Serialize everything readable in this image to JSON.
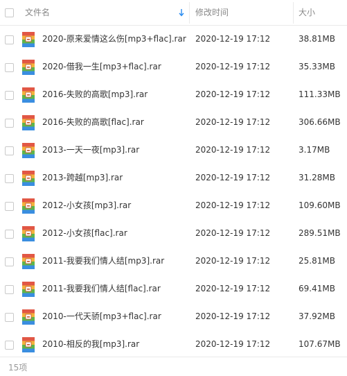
{
  "header": {
    "name_label": "文件名",
    "time_label": "修改时间",
    "size_label": "大小"
  },
  "files": [
    {
      "name": "2020-原来爱情这么伤[mp3+flac].rar",
      "time": "2020-12-19 17:12",
      "size": "38.81MB"
    },
    {
      "name": "2020-借我一生[mp3+flac].rar",
      "time": "2020-12-19 17:12",
      "size": "35.33MB"
    },
    {
      "name": "2016-失败的高歌[mp3].rar",
      "time": "2020-12-19 17:12",
      "size": "111.33MB"
    },
    {
      "name": "2016-失败的高歌[flac].rar",
      "time": "2020-12-19 17:12",
      "size": "306.66MB"
    },
    {
      "name": "2013-一天一夜[mp3].rar",
      "time": "2020-12-19 17:12",
      "size": "3.17MB"
    },
    {
      "name": "2013-跨越[mp3].rar",
      "time": "2020-12-19 17:12",
      "size": "31.28MB"
    },
    {
      "name": "2012-小女孩[mp3].rar",
      "time": "2020-12-19 17:12",
      "size": "109.60MB"
    },
    {
      "name": "2012-小女孩[flac].rar",
      "time": "2020-12-19 17:12",
      "size": "289.51MB"
    },
    {
      "name": "2011-我要我们情人结[mp3].rar",
      "time": "2020-12-19 17:12",
      "size": "25.81MB"
    },
    {
      "name": "2011-我要我们情人结[flac].rar",
      "time": "2020-12-19 17:12",
      "size": "69.41MB"
    },
    {
      "name": "2010-一代天骄[mp3+flac].rar",
      "time": "2020-12-19 17:12",
      "size": "37.92MB"
    },
    {
      "name": "2010-相反的我[mp3].rar",
      "time": "2020-12-19 17:12",
      "size": "107.67MB"
    }
  ],
  "footer": {
    "count_label": "15项"
  },
  "icons": {
    "sort": "sort-down-icon",
    "file": "archive-file-icon"
  },
  "colors": {
    "sort_arrow": "#2a8cf0",
    "checkbox_border": "#c9c9c9",
    "archive_stripes": [
      "#e15745",
      "#f3b33d",
      "#5fb54a",
      "#3a8ee0"
    ]
  }
}
